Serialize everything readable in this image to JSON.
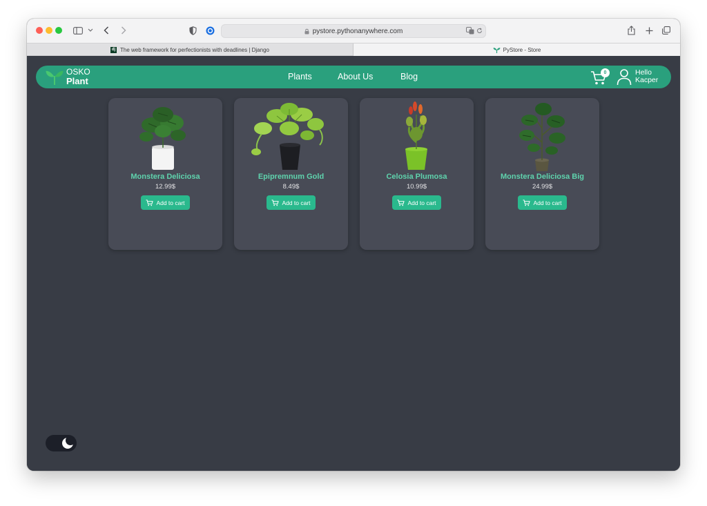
{
  "browser": {
    "url": "pystore.pythonanywhere.com",
    "tabs": [
      {
        "label": "The web framework for perfectionists with deadlines | Django",
        "favicon": "dj"
      },
      {
        "label": "PyStore - Store",
        "favicon": "sprout-icon"
      }
    ],
    "colors": {
      "close": "#fe5f57",
      "minimize": "#febc2e",
      "zoom": "#28c840"
    }
  },
  "nav": {
    "logo_line1": "OSKO",
    "logo_line2": "Plant",
    "links": [
      "Plants",
      "About Us",
      "Blog"
    ],
    "cart_count": "0",
    "greeting_line1": "Hello",
    "greeting_line2": "Kacper",
    "accent": "#2aa07d"
  },
  "products": [
    {
      "name": "Monstera Deliciosa",
      "price": "12.99$",
      "button": "Add to cart"
    },
    {
      "name": "Epipremnum Gold",
      "price": "8.49$",
      "button": "Add to cart"
    },
    {
      "name": "Celosia Plumosa",
      "price": "10.99$",
      "button": "Add to cart"
    },
    {
      "name": "Monstera Deliciosa Big",
      "price": "24.99$",
      "button": "Add to cart"
    }
  ],
  "theme": {
    "background": "#383c45",
    "card": "#484b56",
    "name_color": "#5fd3ad",
    "button_color": "#2ab98d",
    "mode_icon": "moon-icon"
  }
}
